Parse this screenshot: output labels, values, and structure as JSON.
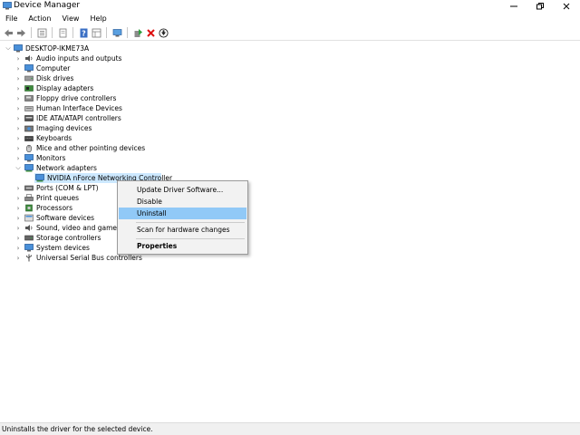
{
  "window": {
    "title": "Device Manager"
  },
  "menu": [
    "File",
    "Action",
    "View",
    "Help"
  ],
  "toolbar": [
    "back-icon",
    "forward-icon",
    "device-view-icon",
    "properties-sheet-icon",
    "help-icon",
    "view-grid-icon",
    "monitor-scan-icon",
    "update-driver-icon",
    "uninstall-icon",
    "download-icon"
  ],
  "tree": {
    "root": "DESKTOP-IKME73A",
    "categories": [
      {
        "label": "Audio inputs and outputs",
        "icon": "audio-icon"
      },
      {
        "label": "Computer",
        "icon": "computer-icon"
      },
      {
        "label": "Disk drives",
        "icon": "disk-drive-icon"
      },
      {
        "label": "Display adapters",
        "icon": "display-adapter-icon"
      },
      {
        "label": "Floppy drive controllers",
        "icon": "floppy-controller-icon"
      },
      {
        "label": "Human Interface Devices",
        "icon": "hid-icon"
      },
      {
        "label": "IDE ATA/ATAPI controllers",
        "icon": "ide-controller-icon"
      },
      {
        "label": "Imaging devices",
        "icon": "imaging-icon"
      },
      {
        "label": "Keyboards",
        "icon": "keyboard-icon"
      },
      {
        "label": "Mice and other pointing devices",
        "icon": "mouse-icon"
      },
      {
        "label": "Monitors",
        "icon": "monitor-icon"
      },
      {
        "label": "Network adapters",
        "icon": "network-adapter-icon"
      },
      {
        "label": "NVIDIA nForce Networking Controller",
        "icon": "network-card-icon"
      },
      {
        "label": "Ports (COM & LPT)",
        "icon": "ports-icon"
      },
      {
        "label": "Print queues",
        "icon": "printer-icon"
      },
      {
        "label": "Processors",
        "icon": "processor-icon"
      },
      {
        "label": "Software devices",
        "icon": "software-device-icon"
      },
      {
        "label": "Sound, video and game controllers",
        "icon": "sound-icon"
      },
      {
        "label": "Storage controllers",
        "icon": "storage-icon"
      },
      {
        "label": "System devices",
        "icon": "system-devices-icon"
      },
      {
        "label": "Universal Serial Bus controllers",
        "icon": "usb-icon"
      }
    ]
  },
  "context_menu": {
    "items": [
      "Update Driver Software...",
      "Disable",
      "Uninstall",
      "Scan for hardware changes",
      "Properties"
    ],
    "highlighted": "Uninstall"
  },
  "status": {
    "text": "Uninstalls the driver for the selected device."
  },
  "colors": {
    "highlight": "#91c9f7",
    "selection": "#cce8ff"
  }
}
